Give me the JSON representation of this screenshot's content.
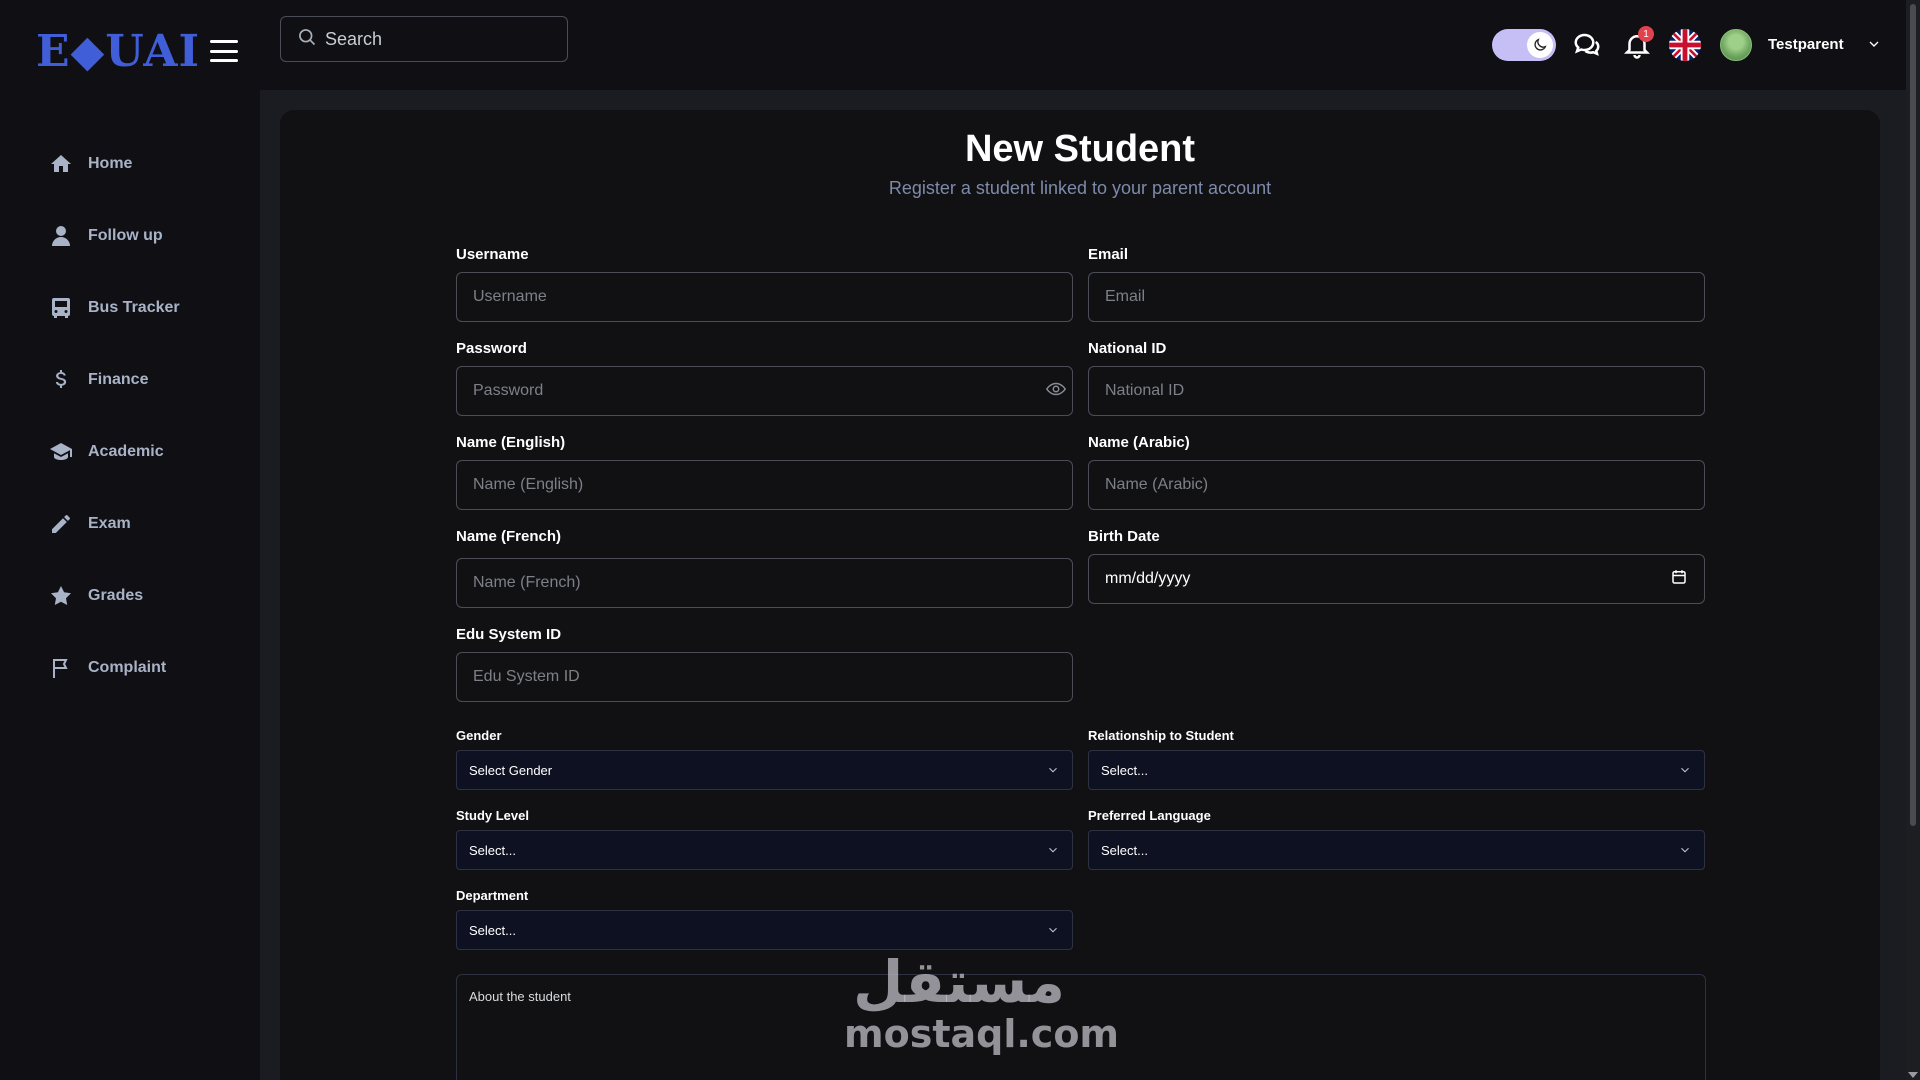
{
  "app": {
    "logo_text": "E◆UAI"
  },
  "sidebar": {
    "items": [
      {
        "label": "Home",
        "icon": "home-icon"
      },
      {
        "label": "Follow up",
        "icon": "user-icon"
      },
      {
        "label": "Bus Tracker",
        "icon": "bus-icon"
      },
      {
        "label": "Finance",
        "icon": "dollar-icon"
      },
      {
        "label": "Academic",
        "icon": "graduation-cap-icon"
      },
      {
        "label": "Exam",
        "icon": "pencil-icon"
      },
      {
        "label": "Grades",
        "icon": "star-icon"
      },
      {
        "label": "Complaint",
        "icon": "flag-icon"
      }
    ]
  },
  "header": {
    "search_placeholder": "Search",
    "notification_count": "1",
    "user_name": "Testparent",
    "theme_mode": "dark",
    "language_flag": "uk-flag-icon"
  },
  "form": {
    "title": "New Student",
    "subtitle": "Register a student linked to your parent account",
    "username": {
      "label": "Username",
      "placeholder": "Username"
    },
    "email": {
      "label": "Email",
      "placeholder": "Email"
    },
    "password": {
      "label": "Password",
      "placeholder": "Password"
    },
    "national_id": {
      "label": "National ID",
      "placeholder": "National ID"
    },
    "name_en": {
      "label": "Name (English)",
      "placeholder": "Name (English)"
    },
    "name_ar": {
      "label": "Name (Arabic)",
      "placeholder": "Name (Arabic)"
    },
    "name_fr": {
      "label": "Name (French)",
      "placeholder": "Name (French)"
    },
    "birth_date": {
      "label": "Birth Date",
      "value": "mm/dd/yyyy"
    },
    "edu_system_id": {
      "label": "Edu System ID",
      "placeholder": "Edu System ID"
    },
    "gender": {
      "label": "Gender",
      "value": "Select Gender"
    },
    "relationship": {
      "label": "Relationship to Student",
      "value": "Select..."
    },
    "study_level": {
      "label": "Study Level",
      "value": "Select..."
    },
    "preferred_language": {
      "label": "Preferred Language",
      "value": "Select..."
    },
    "department": {
      "label": "Department",
      "value": "Select..."
    },
    "about": {
      "placeholder": "About the student"
    }
  },
  "watermark": {
    "arabic": "مستقل",
    "latin": "mostaql.com"
  },
  "colors": {
    "background": "#1b1c21",
    "panel": "#101014",
    "card": "#111114",
    "accent_logo": "#3f5ed8",
    "sidebar_text": "#a9b3c7",
    "subtitle": "#7d8aaa",
    "select_bg": "#0e1122",
    "toggle": "#c6bff6",
    "badge": "#e0434e"
  }
}
